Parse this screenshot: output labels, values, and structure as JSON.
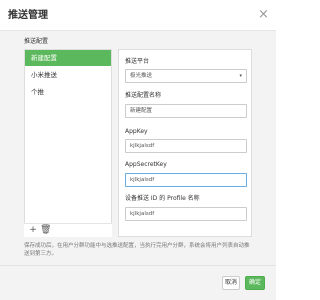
{
  "dialog": {
    "title": "推送管理",
    "close_glyph": "×"
  },
  "section": {
    "label": "推送配置"
  },
  "config_list": {
    "items": [
      {
        "label": "新建配置",
        "active": true
      },
      {
        "label": "小米推送",
        "active": false
      },
      {
        "label": "个推",
        "active": false
      }
    ],
    "add_glyph": "+",
    "delete_glyph": "🗑"
  },
  "form": {
    "platform_label": "推送平台",
    "platform_value": "极光推送",
    "dropdown_glyph": "▾",
    "config_name_label": "推送配置名称",
    "config_name_value": "新建配置",
    "appkey_label": "AppKey",
    "appkey_value": "kjlkjalsdf",
    "appsecret_label": "AppSecretKey",
    "appsecret_value": "kjlkjalsdf",
    "profile_label": "设备推送 ID 的 Profile 名称",
    "profile_value": "kjlkjalsdf"
  },
  "note": "保存成功后，在用户分群功能中与选推送配置，当执行完用户分群，系统会将用户列表自动推送到第三方。",
  "buttons": {
    "cancel": "取消",
    "ok": "确定"
  },
  "colors": {
    "accent": "#5cb85c",
    "focus_border": "#66afe9"
  }
}
